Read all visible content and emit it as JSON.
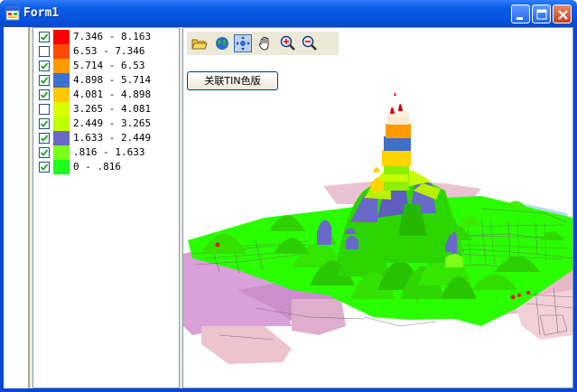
{
  "window": {
    "title": "Form1",
    "controls": [
      "minimize",
      "maximize",
      "close"
    ]
  },
  "toc": {
    "items": [
      {
        "label": "7.346 - 8.163",
        "color": "#ff0000",
        "checked": true
      },
      {
        "label": "6.53 - 7.346",
        "color": "#ff4a00",
        "checked": false
      },
      {
        "label": "5.714 - 6.53",
        "color": "#ff9a00",
        "checked": true
      },
      {
        "label": "4.898 - 5.714",
        "color": "#3f6fd0",
        "checked": true
      },
      {
        "label": "4.081 - 4.898",
        "color": "#ffc800",
        "checked": true
      },
      {
        "label": "3.265 - 4.081",
        "color": "#d8ff00",
        "checked": false
      },
      {
        "label": "2.449 - 3.265",
        "color": "#c0ff00",
        "checked": true
      },
      {
        "label": "1.633 - 2.449",
        "color": "#6a68c8",
        "checked": true
      },
      {
        "label": ".816 - 1.633",
        "color": "#7cff1a",
        "checked": true
      },
      {
        "label": "0 - .816",
        "color": "#1dff1d",
        "checked": true
      }
    ]
  },
  "toolbar": {
    "tools": [
      "open-folder-icon",
      "globe-icon",
      "pan-arrows-icon",
      "hand-icon",
      "zoom-in-icon",
      "zoom-out-icon"
    ]
  },
  "map": {
    "assoc_button": "关联TIN色版"
  }
}
